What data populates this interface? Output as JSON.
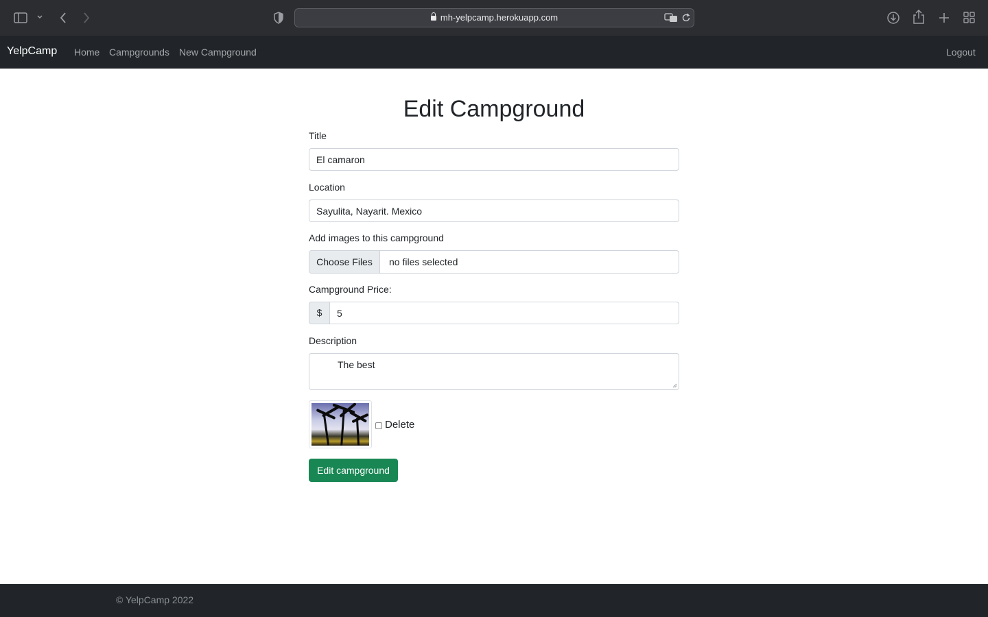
{
  "browser": {
    "url": "mh-yelpcamp.herokuapp.com"
  },
  "navbar": {
    "brand": "YelpCamp",
    "links": [
      "Home",
      "Campgrounds",
      "New Campground"
    ],
    "logout": "Logout"
  },
  "form": {
    "heading": "Edit Campground",
    "title_label": "Title",
    "title_value": "El camaron",
    "location_label": "Location",
    "location_value": "Sayulita, Nayarit. Mexico",
    "images_label": "Add images to this campground",
    "choose_files": "Choose Files",
    "file_status": "no files selected",
    "price_label": "Campground Price:",
    "price_prefix": "$",
    "price_value": "5",
    "description_label": "Description",
    "description_value": "The best",
    "delete_label": "Delete",
    "submit_label": "Edit campground"
  },
  "footer": {
    "text": "© YelpCamp 2022"
  },
  "colors": {
    "navbar_bg": "#212529",
    "success": "#198754"
  }
}
